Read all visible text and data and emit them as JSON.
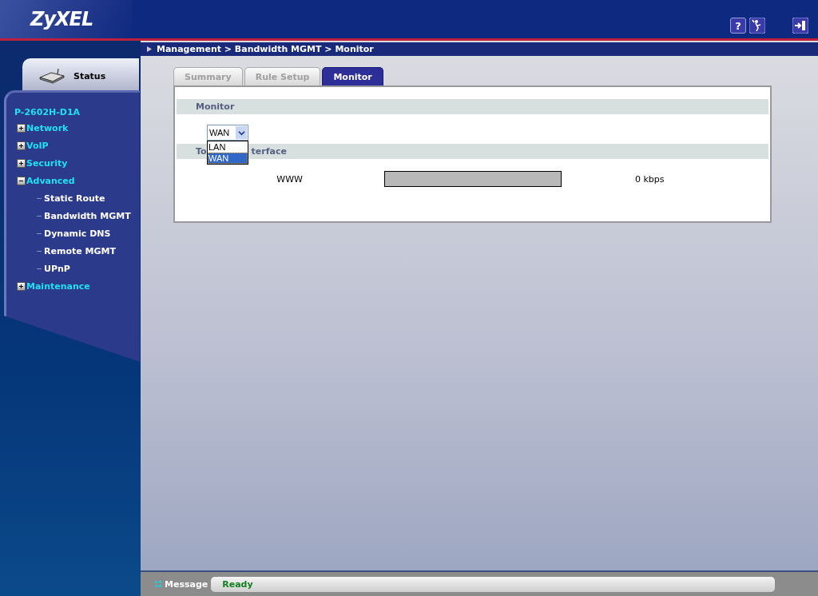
{
  "header": {
    "logo": "ZyXEL",
    "help_icon_text": "?"
  },
  "sidebar": {
    "status_tab": "Status",
    "device": "P-2602H-D1A",
    "items": [
      {
        "label": "Network",
        "expanded": false
      },
      {
        "label": "VoIP",
        "expanded": false
      },
      {
        "label": "Security",
        "expanded": false
      },
      {
        "label": "Advanced",
        "expanded": true,
        "children": [
          {
            "label": "Static Route"
          },
          {
            "label": "Bandwidth MGMT"
          },
          {
            "label": "Dynamic DNS"
          },
          {
            "label": "Remote MGMT"
          },
          {
            "label": "UPnP"
          }
        ]
      },
      {
        "label": "Maintenance",
        "expanded": false
      }
    ]
  },
  "breadcrumb": "Management > Bandwidth MGMT > Monitor",
  "tabs": [
    {
      "label": "Summary",
      "selected": false
    },
    {
      "label": "Rule Setup",
      "selected": false
    },
    {
      "label": "Monitor",
      "selected": true
    }
  ],
  "monitor_section": {
    "title": "Monitor",
    "select_value": "WAN",
    "options": [
      {
        "label": "LAN",
        "selected": false
      },
      {
        "label": "WAN",
        "selected": true
      }
    ]
  },
  "interface_section": {
    "title_visible_parts": [
      "To",
      "terface"
    ],
    "rows": [
      {
        "name": "WWW",
        "reading": "0 kbps"
      }
    ]
  },
  "status_bar": {
    "label": "Message",
    "message": "Ready"
  }
}
